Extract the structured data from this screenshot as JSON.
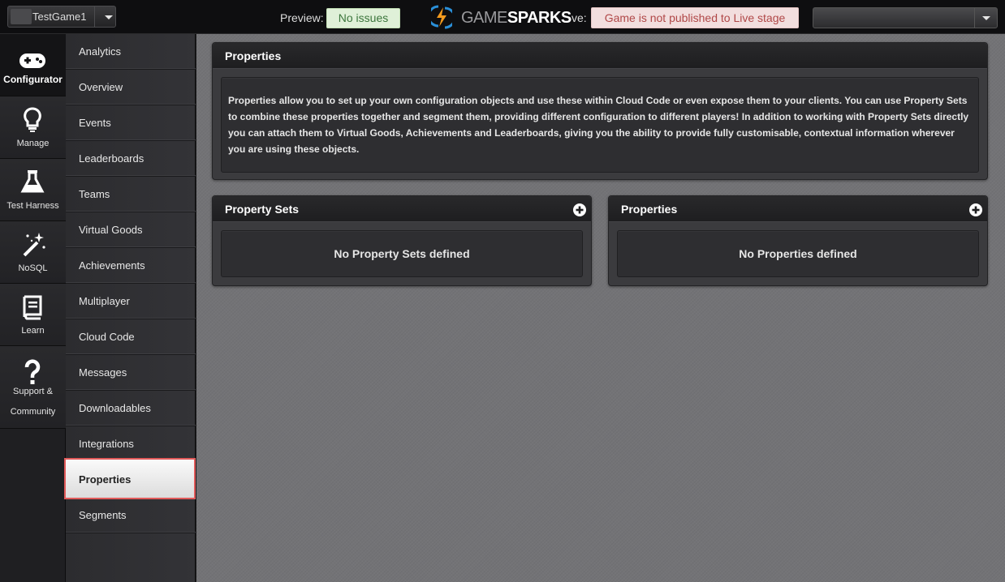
{
  "topbar": {
    "game_name": "TestGame1",
    "preview_label": "Preview:",
    "preview_status": "No issues",
    "logo_prefix": "GAME",
    "logo_suffix": "SPARKS",
    "live_label_partial": "ve:",
    "live_status": "Game is not published to Live stage",
    "colors": {
      "preview_badge_bg": "#dff0d8",
      "preview_badge_text": "#3c763d",
      "live_badge_bg": "#f2dede",
      "live_badge_text": "#b04848",
      "logo_orange": "#f39a1e",
      "logo_blue": "#2a8fd8"
    }
  },
  "iconbar": {
    "items": [
      {
        "label": "Configurator",
        "icon": "gamepad-icon",
        "active": true
      },
      {
        "label": "Manage",
        "icon": "lightbulb-icon"
      },
      {
        "label": "Test Harness",
        "icon": "flask-icon"
      },
      {
        "label": "NoSQL",
        "icon": "magic-wand-icon"
      },
      {
        "label": "Learn",
        "icon": "book-icon"
      },
      {
        "label_line1": "Support &",
        "label_line2": "Community",
        "icon": "question-icon"
      }
    ]
  },
  "subnav": {
    "items": [
      {
        "label": "Analytics"
      },
      {
        "label": "Overview"
      },
      {
        "label": "Events"
      },
      {
        "label": "Leaderboards"
      },
      {
        "label": "Teams"
      },
      {
        "label": "Virtual Goods"
      },
      {
        "label": "Achievements"
      },
      {
        "label": "Multiplayer"
      },
      {
        "label": "Cloud Code"
      },
      {
        "label": "Messages"
      },
      {
        "label": "Downloadables"
      },
      {
        "label": "Integrations"
      },
      {
        "label": "Properties",
        "active": true
      },
      {
        "label": "Segments"
      }
    ],
    "active_highlight_color": "#e15a5a"
  },
  "main": {
    "properties_panel": {
      "title": "Properties",
      "description": "Properties allow you to set up your own configuration objects and use these within Cloud Code or even expose them to your clients. You can use Property Sets to combine these properties together and segment them, providing different configuration to different players! In addition to working with Property Sets directly you can attach them to Virtual Goods, Achievements and Leaderboards, giving you the ability to provide fully customisable, contextual information wherever you are using these objects."
    },
    "property_sets_panel": {
      "title": "Property Sets",
      "empty_message": "No Property Sets defined",
      "add_icon": "plus-circle-icon"
    },
    "properties_list_panel": {
      "title": "Properties",
      "empty_message": "No Properties defined",
      "add_icon": "plus-circle-icon"
    }
  }
}
